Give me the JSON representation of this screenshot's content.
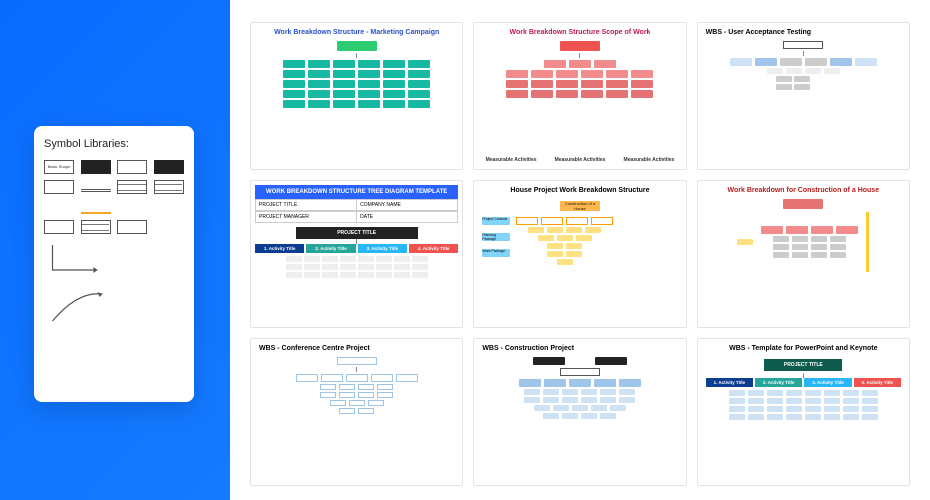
{
  "symbol_panel": {
    "title": "Symbol Libraries:",
    "shape_labels": [
      "Basic Shape",
      "",
      "",
      ""
    ]
  },
  "templates": [
    {
      "title": "Work Breakdown Structure - Marketing Campaign",
      "title_color": "#2952cc",
      "palette": "teal"
    },
    {
      "title": "Work Breakdown Structure Scope of Work",
      "title_color": "#c2185b",
      "palette": "pink",
      "captions": [
        "Measurable Activities",
        "Measurable Activities",
        "Measurable Activities"
      ]
    },
    {
      "title": "WBS - User Acceptance Testing",
      "title_color": "#222",
      "title_align": "left",
      "palette": "bluegrey"
    },
    {
      "header": "WORK BREAKDOWN STRUCTURE TREE DIAGRAM TEMPLATE",
      "meta": [
        {
          "label": "PROJECT TITLE",
          "value": "COMPANY NAME"
        },
        {
          "label": "PROJECT MANAGER",
          "value": "DATE"
        }
      ],
      "root": "PROJECT TITLE",
      "pills": [
        "1. Activity Title",
        "2. Activity Title",
        "3. Activity Title",
        "4. Activity Title"
      ],
      "pill_colors": [
        "#0b3d91",
        "#26a69a",
        "#29b6f6",
        "#ef5350"
      ]
    },
    {
      "title": "House Project Work Breakdown Structure",
      "subtitle": "Construction of a House",
      "title_color": "#111",
      "palette": "house",
      "left_labels": [
        "Project Controls",
        "Planning Package",
        "Work Package"
      ]
    },
    {
      "title": "Work Breakdown for Construction of a House",
      "title_color": "#b71c1c",
      "palette": "redgrey"
    },
    {
      "title": "WBS - Conference Centre Project",
      "title_color": "#222",
      "title_align": "left",
      "palette": "skyblue"
    },
    {
      "title": "WBS - Construction Project",
      "title_color": "#222",
      "title_align": "left",
      "palette": "mixed"
    },
    {
      "title": "WBS - Template for PowerPoint and Keynote",
      "title_color": "#222",
      "root": "PROJECT TITLE",
      "pills": [
        "1. Activity Title",
        "2. Activity Title",
        "3. Activity Title",
        "4. Activity Title"
      ],
      "pill_colors": [
        "#0b3d91",
        "#26a69a",
        "#29b6f6",
        "#ef5350"
      ]
    }
  ]
}
